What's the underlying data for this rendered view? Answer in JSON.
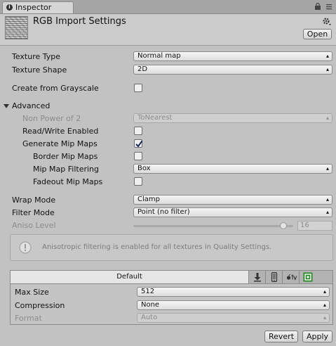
{
  "tab": {
    "label": "Inspector"
  },
  "header": {
    "title": "RGB Import Settings",
    "open_label": "Open"
  },
  "settings": {
    "texture_type": {
      "label": "Texture Type",
      "value": "Normal map"
    },
    "texture_shape": {
      "label": "Texture Shape",
      "value": "2D"
    },
    "create_from_grayscale": {
      "label": "Create from Grayscale",
      "checked": false
    }
  },
  "advanced": {
    "label": "Advanced",
    "non_power_of_2": {
      "label": "Non Power of 2",
      "value": "ToNearest",
      "disabled": true
    },
    "read_write": {
      "label": "Read/Write Enabled",
      "checked": false
    },
    "generate_mip": {
      "label": "Generate Mip Maps",
      "checked": true
    },
    "border_mip": {
      "label": "Border Mip Maps",
      "checked": false
    },
    "mip_filtering": {
      "label": "Mip Map Filtering",
      "value": "Box"
    },
    "fadeout_mip": {
      "label": "Fadeout Mip Maps",
      "checked": false
    }
  },
  "wrap_mode": {
    "label": "Wrap Mode",
    "value": "Clamp"
  },
  "filter_mode": {
    "label": "Filter Mode",
    "value": "Point (no filter)"
  },
  "aniso": {
    "label": "Aniso Level",
    "value": "16",
    "level_fraction": 0.94,
    "disabled": true
  },
  "info": {
    "text": "Anisotropic filtering is enabled for all textures in Quality Settings."
  },
  "platform": {
    "tabs": [
      {
        "name": "Default"
      },
      {
        "icon": "download-icon"
      },
      {
        "icon": "phone-icon"
      },
      {
        "icon": "appletv-icon"
      },
      {
        "icon": "xbox-icon",
        "color": "#2a8a2a"
      }
    ],
    "max_size": {
      "label": "Max Size",
      "value": "512"
    },
    "compression": {
      "label": "Compression",
      "value": "None"
    },
    "format": {
      "label": "Format",
      "value": "Auto",
      "disabled": true
    }
  },
  "buttons": {
    "revert": "Revert",
    "apply": "Apply"
  },
  "colors": {
    "window_bg": "#c2c2c2",
    "accent_green": "#2a8a2a"
  }
}
